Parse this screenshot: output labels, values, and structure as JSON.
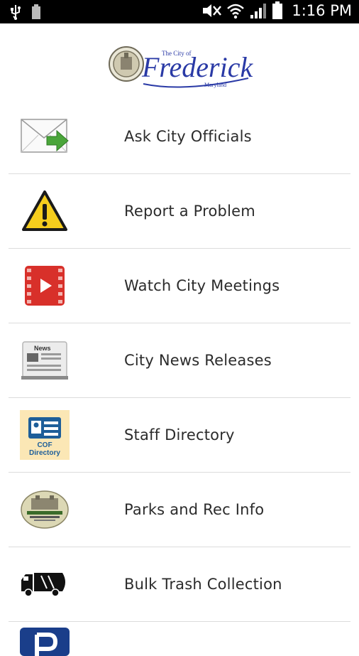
{
  "status_bar": {
    "time": "1:16 PM",
    "icons": [
      "usb-icon",
      "battery-small-icon",
      "mute-icon",
      "wifi-icon",
      "signal-icon",
      "battery-icon"
    ]
  },
  "header": {
    "logo_text_small": "The City of",
    "logo_text_main": "Frederick",
    "logo_text_sub": "Maryland"
  },
  "menu": {
    "items": [
      {
        "label": "Ask City Officials",
        "icon": "envelope-arrow-icon"
      },
      {
        "label": "Report a Problem",
        "icon": "warning-icon"
      },
      {
        "label": "Watch City Meetings",
        "icon": "video-play-icon"
      },
      {
        "label": "City News Releases",
        "icon": "newspaper-icon",
        "icon_text": "News"
      },
      {
        "label": "Staff Directory",
        "icon": "directory-card-icon",
        "icon_text": "COF Directory"
      },
      {
        "label": "Parks and Rec Info",
        "icon": "parks-rec-logo-icon"
      },
      {
        "label": "Bulk Trash Collection",
        "icon": "truck-icon"
      },
      {
        "label": "",
        "icon": "parking-icon"
      }
    ]
  },
  "colors": {
    "status_bar_bg": "#000000",
    "logo_blue": "#2a3aa6",
    "divider": "#dcdcdc",
    "label_text": "#2b2b2b"
  }
}
